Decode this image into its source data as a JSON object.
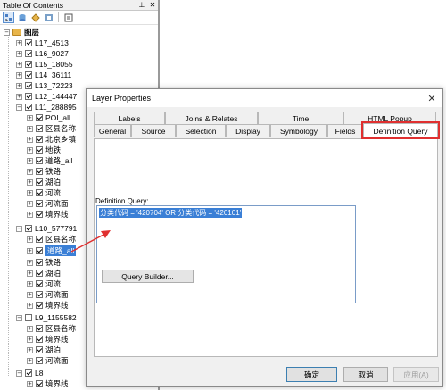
{
  "toc": {
    "title": "Table Of Contents",
    "root_label": "图层",
    "groups": [
      {
        "label": "L17_4513",
        "expanded": false,
        "checked": true
      },
      {
        "label": "L16_9027",
        "expanded": false,
        "checked": true
      },
      {
        "label": "L15_18055",
        "expanded": false,
        "checked": true
      },
      {
        "label": "L14_36111",
        "expanded": false,
        "checked": true
      },
      {
        "label": "L13_72223",
        "expanded": false,
        "checked": true
      },
      {
        "label": "L12_144447",
        "expanded": false,
        "checked": true
      },
      {
        "label": "L11_288895",
        "expanded": true,
        "checked": true,
        "children": [
          "POI_all",
          "区县名称",
          "北京乡镇",
          "地铁",
          "道路_all",
          "铁路",
          "湖泊",
          "河流",
          "河流面",
          "境界线"
        ]
      },
      {
        "label": "L10_577791",
        "expanded": true,
        "checked": true,
        "children": [
          "区县名称",
          "道路_all",
          "铁路",
          "湖泊",
          "河流",
          "河流面",
          "境界线"
        ],
        "selected_child": 1
      },
      {
        "label": "L9_1155582",
        "expanded": true,
        "checked": false,
        "children": [
          "区县名称",
          "境界线",
          "湖泊",
          "河流面"
        ]
      },
      {
        "label": "L8",
        "expanded": true,
        "checked": true,
        "children": [
          "境界线"
        ]
      }
    ]
  },
  "dialog": {
    "title": "Layer Properties",
    "tabs_row1": [
      "Labels",
      "Joins & Relates",
      "Time",
      "HTML Popup"
    ],
    "tabs_row2": [
      "General",
      "Source",
      "Selection",
      "Display",
      "Symbology",
      "Fields",
      "Definition Query"
    ],
    "active_tab": "Definition Query",
    "definition_query_label": "Definition Query:",
    "definition_query_value": "分类代码 = '420704' OR 分类代码 = '420101'",
    "query_builder_label": "Query Builder...",
    "ok_label": "确定",
    "cancel_label": "取消",
    "apply_label": "应用(A)"
  },
  "colors": {
    "highlight": "#e03030",
    "selection": "#3a7fd6"
  }
}
